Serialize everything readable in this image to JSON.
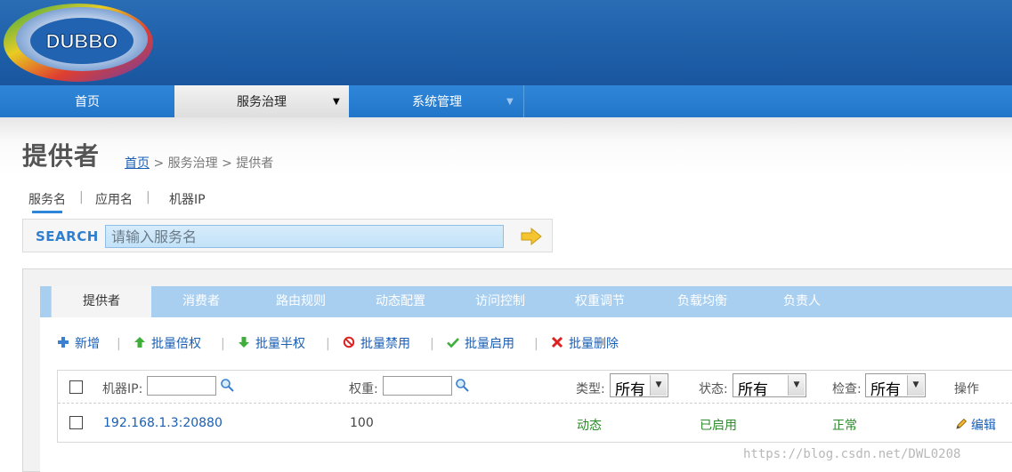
{
  "logo": {
    "text": "DUBBO"
  },
  "nav": {
    "items": [
      {
        "label": "首页"
      },
      {
        "label": "服务治理",
        "caret": "▼"
      },
      {
        "label": "系统管理",
        "caret": "▼"
      }
    ]
  },
  "page": {
    "title": "提供者",
    "breadcrumb": {
      "home": "首页",
      "sep1": " > ",
      "section": "服务治理",
      "sep2": " > ",
      "current": "提供者"
    }
  },
  "search": {
    "tabs": [
      "服务名",
      "应用名",
      "机器IP"
    ],
    "separator": "|",
    "label": "SEARCH",
    "placeholder": "请输入服务名"
  },
  "tabs": [
    "提供者",
    "消费者",
    "路由规则",
    "动态配置",
    "访问控制",
    "权重调节",
    "负载均衡",
    "负责人"
  ],
  "toolbar": {
    "separator": "|",
    "actions": [
      {
        "label": "新增",
        "icon": "plus-icon"
      },
      {
        "label": "批量倍权",
        "icon": "arrow-up-icon"
      },
      {
        "label": "批量半权",
        "icon": "arrow-down-icon"
      },
      {
        "label": "批量禁用",
        "icon": "ban-icon"
      },
      {
        "label": "批量启用",
        "icon": "check-icon"
      },
      {
        "label": "批量删除",
        "icon": "cross-icon"
      }
    ]
  },
  "table": {
    "headers": {
      "ip": "机器IP:",
      "weight": "权重:",
      "type": "类型:",
      "status": "状态:",
      "check": "检查:",
      "ops": "操作"
    },
    "filters": {
      "type": "所有",
      "status": "所有",
      "check": "所有"
    },
    "rows": [
      {
        "ip": "192.168.1.3:20880",
        "weight": "100",
        "type": "动态",
        "status": "已启用",
        "check": "正常",
        "op": "编辑"
      }
    ]
  },
  "colors": {
    "header_blue": "#1e5fa8",
    "nav_blue": "#2276c9",
    "tab_blue": "#a9cff0",
    "link": "#1a5fb4",
    "green": "#2c8a2c"
  },
  "watermark": "https://blog.csdn.net/DWL0208"
}
